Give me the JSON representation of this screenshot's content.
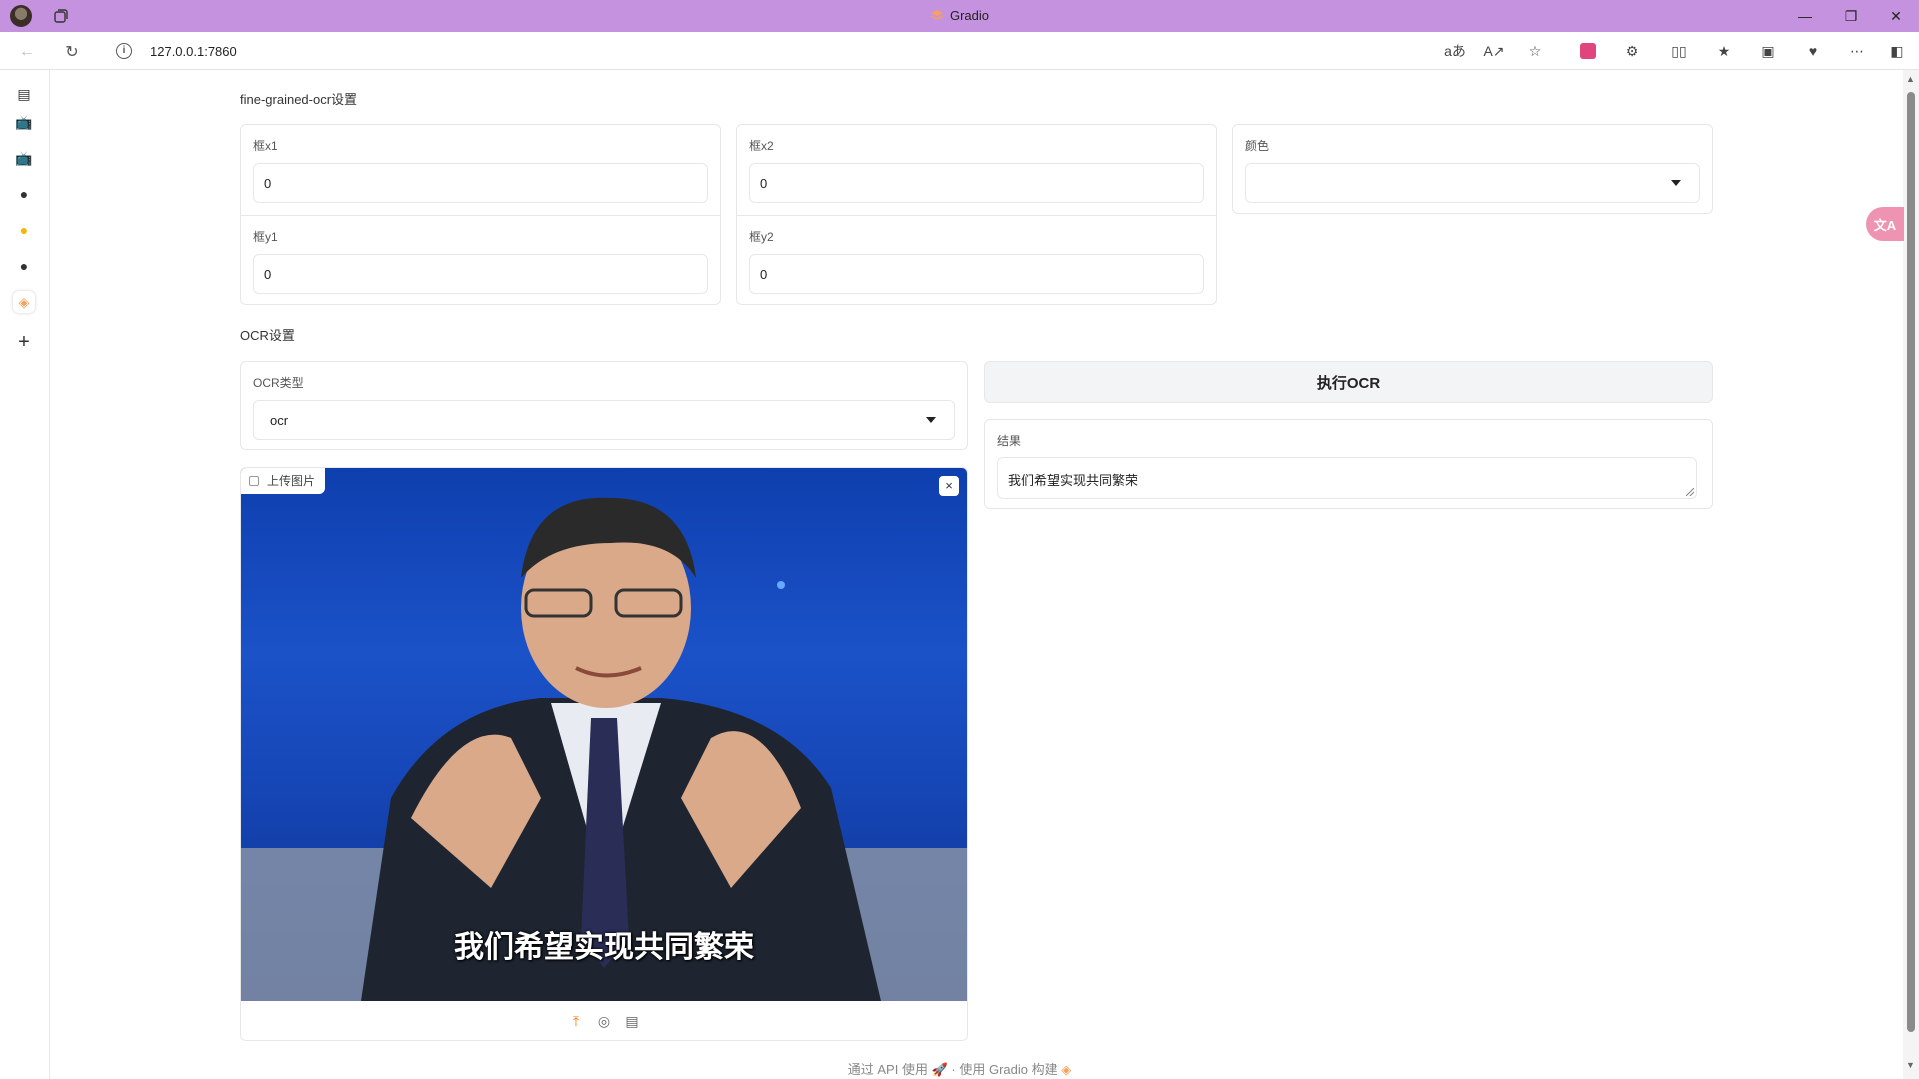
{
  "window": {
    "title": "Gradio",
    "accent": "#c592df"
  },
  "browser": {
    "url": "127.0.0.1:7860",
    "toolbar_icons": [
      "read-aloud-translate-icon",
      "read-aloud-icon",
      "favorite-star-icon",
      "app-pink-icon",
      "extensions-icon",
      "split-screen-icon",
      "favorites-icon",
      "collections-icon",
      "performance-icon",
      "more-icon",
      "sidebar-toggle-icon"
    ]
  },
  "sidebar": {
    "items": [
      "tab-icon",
      "bilibili-icon",
      "bilibili-icon",
      "github-icon",
      "chat-bot-icon",
      "github-icon",
      "gradio-icon",
      "add-icon"
    ]
  },
  "finegrained": {
    "section_label": "fine-grained-ocr设置",
    "x1_label": "框x1",
    "x1_value": "0",
    "x2_label": "框x2",
    "x2_value": "0",
    "y1_label": "框y1",
    "y1_value": "0",
    "y2_label": "框y2",
    "y2_value": "0",
    "color_label": "颜色",
    "color_value": ""
  },
  "ocr": {
    "section_label": "OCR设置",
    "type_label": "OCR类型",
    "type_value": "ocr",
    "run_button": "执行OCR",
    "result_label": "结果",
    "result_value": "我们希望实现共同繁荣"
  },
  "image_upload": {
    "tag_label": "上传图片",
    "caption_text": "我们希望实现共同繁荣",
    "close_symbol": "×"
  },
  "footer": {
    "api_text": "通过 API 使用",
    "separator": "·",
    "built_text": "使用 Gradio 构建"
  }
}
